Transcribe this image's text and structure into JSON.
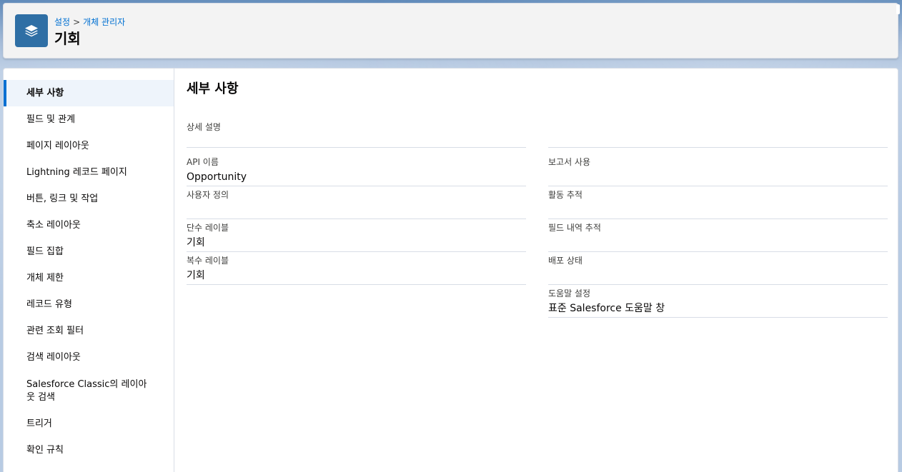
{
  "header": {
    "breadcrumb": [
      "설정",
      "개체 관리자"
    ],
    "breadcrumb_separator": ">",
    "title": "기회",
    "icon": "stacked-layers-icon"
  },
  "sidebar": {
    "items": [
      {
        "label": "세부 사항",
        "active": true
      },
      {
        "label": "필드 및 관계"
      },
      {
        "label": "페이지 레이아웃"
      },
      {
        "label": "Lightning 레코드 페이지"
      },
      {
        "label": "버튼, 링크 및 작업"
      },
      {
        "label": "축소 레이아웃"
      },
      {
        "label": "필드 집합"
      },
      {
        "label": "개체 제한"
      },
      {
        "label": "레코드 유형"
      },
      {
        "label": "관련 조회 필터"
      },
      {
        "label": "검색 레이아웃"
      },
      {
        "label": "Salesforce Classic의 레이아웃 검색"
      },
      {
        "label": "트리거"
      },
      {
        "label": "확인 규칙"
      }
    ]
  },
  "details": {
    "title": "세부 사항",
    "description": {
      "label": "상세 설명",
      "value": ""
    },
    "left_fields": [
      {
        "label": "API 이름",
        "value": "Opportunity"
      },
      {
        "label": "사용자 정의",
        "value": ""
      },
      {
        "label": "단수 레이블",
        "value": "기회"
      },
      {
        "label": "복수 레이블",
        "value": "기회"
      }
    ],
    "right_fields": [
      {
        "label": "보고서 사용",
        "value": ""
      },
      {
        "label": "활동 추적",
        "value": ""
      },
      {
        "label": "필드 내역 추적",
        "value": ""
      },
      {
        "label": "배포 상태",
        "value": ""
      },
      {
        "label": "도움말 설정",
        "value": "표준 Salesforce 도움말 창"
      }
    ]
  },
  "colors": {
    "accent": "#0070d2",
    "icon_bg": "#2f6fa5",
    "active_bg": "#eef4fb"
  }
}
